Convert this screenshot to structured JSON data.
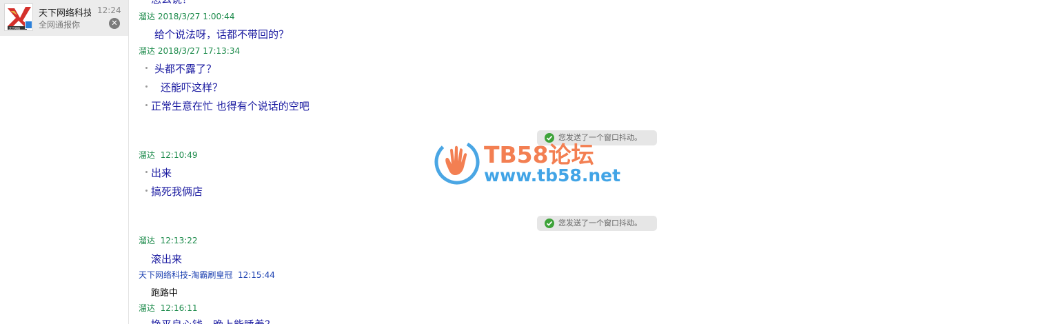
{
  "sidebar": {
    "contact": {
      "name": "天下网络科技",
      "time": "12:24",
      "preview": "全网通报你",
      "close_symbol": "✕"
    }
  },
  "chat": {
    "top_partial_text": "怎么说？",
    "messages": [
      {
        "sender": "溜达",
        "timestamp": "2018/3/27 1:00:44",
        "lines": [
          "给个说法呀，话都不带回的？"
        ]
      },
      {
        "sender": "溜达",
        "timestamp": "2018/3/27 17:13:34",
        "lines": [
          "头都不露了？",
          "还能吓这样？",
          "正常生意在忙 也得有个说话的空吧"
        ]
      },
      {
        "sender": "溜达",
        "timestamp": "12:10:49",
        "lines": [
          "出来",
          "搞死我俩店"
        ]
      },
      {
        "sender": "溜达",
        "timestamp": "12:13:22",
        "lines": [
          "滚出来"
        ]
      },
      {
        "sender": "天下网络科技-淘霸刷皇冠",
        "timestamp": "12:15:44",
        "lines": [
          "跑路中"
        ]
      },
      {
        "sender": "溜达",
        "timestamp": "12:16:11",
        "lines": [
          "挣平良心钱，晚上能睡着？"
        ]
      }
    ],
    "notices": [
      {
        "text": "您发送了一个窗口抖动。"
      },
      {
        "text": "您发送了一个窗口抖动。"
      }
    ]
  },
  "watermark": {
    "title": "TB58论坛",
    "url": "www.tb58.net"
  },
  "colors": {
    "sender_green": "#1b8a4a",
    "sender_blue": "#1a3fb0",
    "message_blue": "#1a1aa0",
    "watermark_orange": "#f37f52",
    "watermark_blue": "#41a4e6",
    "notice_check": "#3ea33a"
  },
  "icons": {
    "avatar": "company-logo-icon",
    "close": "close-icon",
    "notice": "check-circle-icon",
    "watermark": "hand-logo-icon"
  }
}
